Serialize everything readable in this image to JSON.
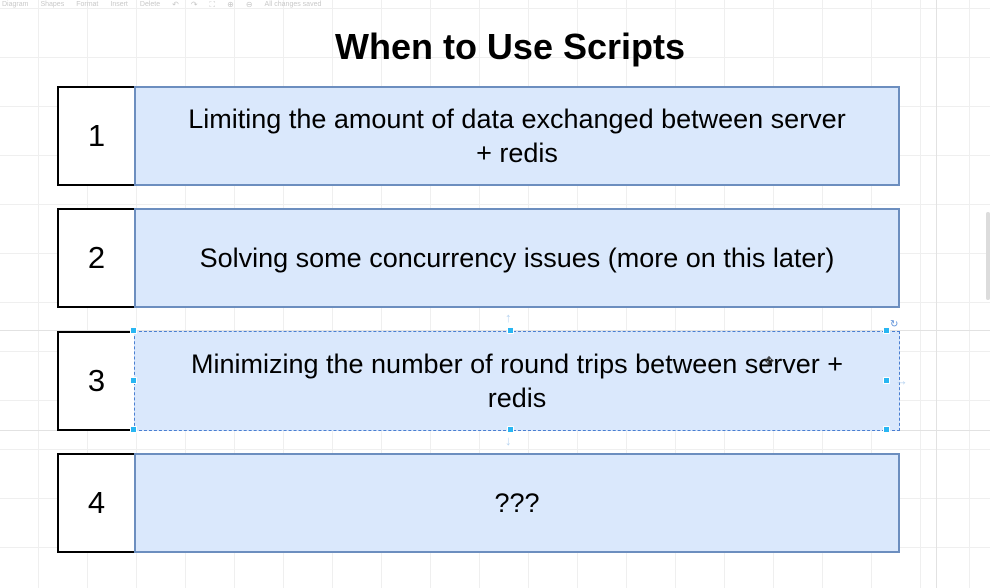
{
  "toolbar": {
    "items": [
      "Diagram",
      "Shapes",
      "Format",
      "Insert",
      "Delete"
    ],
    "status": "All changes saved"
  },
  "diagram": {
    "title": "When to Use Scripts",
    "rows": [
      {
        "number": "1",
        "lines": [
          "Limiting the amount of data exchanged between server",
          "+ redis"
        ]
      },
      {
        "number": "2",
        "lines": [
          "Solving some concurrency issues (more on this later)"
        ]
      },
      {
        "number": "3",
        "lines": [
          "Minimizing the number of round trips between server +",
          "redis"
        ]
      },
      {
        "number": "4",
        "lines": [
          "???"
        ]
      }
    ]
  },
  "colors": {
    "box_fill": "#dae8fc",
    "box_stroke": "#6c8ebf",
    "number_stroke": "#000000",
    "selection": "#29b6f2"
  },
  "icons": [
    "undo-icon",
    "redo-icon",
    "fit-icon",
    "zoom-in-icon",
    "zoom-out-icon",
    "rotate-handle-icon",
    "connect-arrow-icon",
    "move-cursor-icon"
  ]
}
